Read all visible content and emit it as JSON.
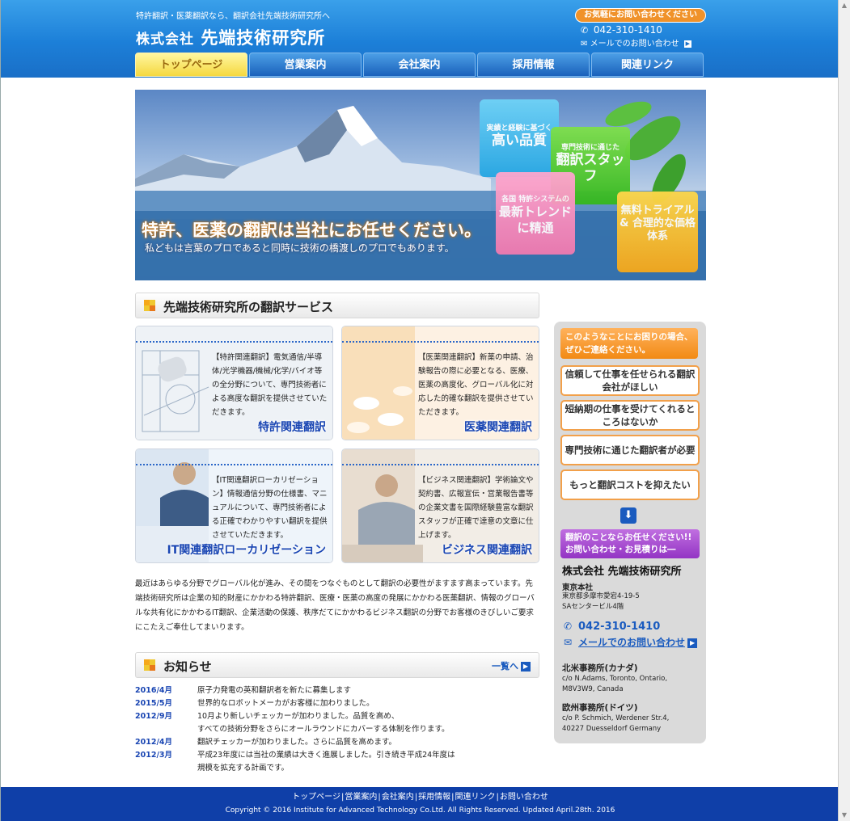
{
  "header": {
    "tagline": "特許翻訳・医薬翻訳なら、翻訳会社先端技術研究所へ",
    "logo_prefix": "株式会社",
    "logo_name": "先端技術研究所",
    "contact_pill": "お気軽にお問い合わせください",
    "phone": "042-310-1410",
    "mail_link": "メールでのお問い合わせ"
  },
  "nav": {
    "tabs": [
      "トップページ",
      "営業案内",
      "会社案内",
      "採用情報",
      "関連リンク"
    ],
    "active_index": 0
  },
  "hero": {
    "headline": "特許、医薬の翻訳は当社にお任せください。",
    "subline": "私どもは言葉のプロであると同時に技術の橋渡しのプロでもあります。",
    "box1_small": "実績と経験に基づく",
    "box1_large": "高い品質",
    "box2_small": "専門技術に通じた",
    "box2_large": "翻訳スタッフ",
    "box3_small": "各国 特許システムの",
    "box3_large": "最新トレンドに精通",
    "box4_large": "無料トライアル & 合理的な価格体系"
  },
  "services": {
    "title": "先端技術研究所の翻訳サービス",
    "cards": [
      {
        "text": "【特許関連翻訳】電気通信/半導体/光学機器/機械/化学/バイオ等の全分野について、専門技術者による高度な翻訳を提供させていただきます。",
        "name": "特許関連翻訳"
      },
      {
        "text": "【医薬関連翻訳】新薬の申請、治験報告の際に必要となる、医療、医薬の高度化、グローバル化に対応した的確な翻訳を提供させていただきます。",
        "name": "医薬関連翻訳"
      },
      {
        "text": "【IT関連翻訳ローカリゼーション】情報通信分野の仕様書、マニュアルについて、専門技術者による正確でわかりやすい翻訳を提供させていただきます。",
        "name": "IT関連翻訳ローカリゼーション"
      },
      {
        "text": "【ビジネス関連翻訳】学術論文や契約書、広報宣伝・営業報告書等の企業文書を国際経験豊富な翻訳スタッフが正確で達意の文章に仕上げます。",
        "name": "ビジネス関連翻訳"
      }
    ]
  },
  "intro": "最近はあらゆる分野でグローバル化が進み、その間をつなぐものとして翻訳の必要性がますます高まっています。先端技術研究所は企業の知的財産にかかわる特許翻訳、医療・医薬の高度の発展にかかわる医薬翻訳、情報のグローバルな共有化にかかわるIT翻訳、企業活動の保護、秩序だてにかかわるビジネス翻訳の分野でお客様のきびしいご要求にこたえご奉仕してまいります。",
  "news": {
    "title": "お知らせ",
    "more": "一覧へ",
    "items": [
      {
        "date": "2016/4月",
        "lines": [
          "原子力発電の英和翻訳者を新たに募集します"
        ]
      },
      {
        "date": "2015/5月",
        "lines": [
          "世界的なロボットメーカがお客様に加わりました。"
        ]
      },
      {
        "date": "2012/9月",
        "lines": [
          "10月より新しいチェッカーが加わりました。品質を高め、",
          "すべての技術分野をさらにオールラウンドにカバーする体制を作ります。"
        ]
      },
      {
        "date": "2012/4月",
        "lines": [
          "翻訳チェッカーが加わりました。さらに品質を高めます。"
        ]
      },
      {
        "date": "2012/3月",
        "lines": [
          "平成23年度には当社の業績は大きく進展しました。引き続き平成24年度は",
          "規模を拡充する計画です。"
        ]
      }
    ]
  },
  "sidebar": {
    "orange_banner": "このようなことにお困りの場合、ぜひご連絡ください。",
    "questions": [
      "信頼して仕事を任せられる翻訳会社がほしい",
      "短納期の仕事を受けてくれるところはないか",
      "専門技術に通じた翻訳者が必要",
      "もっと翻訳コストを抑えたい"
    ],
    "purple_banner": "翻訳のことならお任せください!! お問い合わせ・お見積りは―",
    "company": "株式会社 先端技術研究所",
    "hq_label": "東京本社",
    "hq_address": [
      "東京都多摩市愛宕4-19-5",
      "SAセンタービル4階"
    ],
    "phone": "042-310-1410",
    "mail_link": "メールでのお問い合わせ",
    "offices": [
      {
        "name": "北米事務所(カナダ)",
        "address": [
          "c/o N.Adams, Toronto, Ontario,",
          "M8V3W9, Canada"
        ]
      },
      {
        "name": "欧州事務所(ドイツ)",
        "address": [
          "c/o P. Schmich, Werdener Str.4,",
          "40227 Duesseldorf Germany"
        ]
      }
    ]
  },
  "footer": {
    "links": [
      "トップページ",
      "営業案内",
      "会社案内",
      "採用情報",
      "関連リンク",
      "お問い合わせ"
    ],
    "copyright": "Copyright © 2016 Institute for Advanced Technology Co.Ltd. All Rights Reserved. Updated April.28th. 2016"
  },
  "colors": {
    "header_blue": "#1c7fd8",
    "footer_blue": "#0f3fa8",
    "accent_orange": "#f28a14",
    "link_blue": "#1a46b3"
  }
}
